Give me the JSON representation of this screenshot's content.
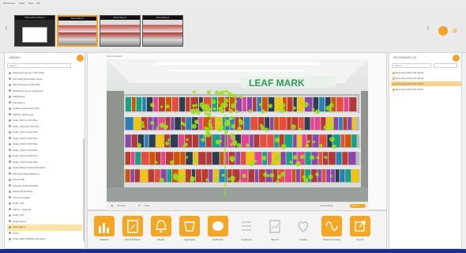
{
  "menubar": {
    "items": [
      "Workspace",
      "Study",
      "Help",
      "Info"
    ]
  },
  "filmstrip": {
    "thumbnails": [
      {
        "caption": "Scene/Recording 1",
        "label": "Scene/Recording",
        "selected": false
      },
      {
        "caption": "Recording 2",
        "selected": true
      },
      {
        "caption": "Recording 3",
        "selected": false
      },
      {
        "caption": "Recording 4",
        "selected": false
      }
    ]
  },
  "library": {
    "title": "LIBRARY",
    "search_placeholder": "Search",
    "items": [
      "Participant Group 1 (F01-F09)",
      "F01 Shelf View Study Group",
      "F02 Participant (F05-F08)",
      "Participant Group (Aug/Sept)",
      "Participants",
      "F03 Gaze 1",
      "Healthy Foods (F01-F09)",
      "F04/F5 - Shelf Light",
      "Study_F01 for F01 Plan",
      "Study_F01-F02 F01 Plan",
      "Study_F02 for F01 Plan",
      "Study_F02 for F02 Plan",
      "Study_F03 for F03 Plan",
      "Study_F03 for F04 Plan",
      "Study_F04 for F05 Plan",
      "Study_F04 for F06 Plan",
      "Study Markers (F01-F09) 2019",
      "F05 Final Shelf Markers F",
      "Variant A/B",
      "Selection (F01-F09 A/B)",
      "Variant Recordings",
      "Video Annotated",
      "Study_F09",
      "F06 10 - Shelf 04",
      "Study_F07",
      "Study Export",
      "Shelf aisle 3",
      "F0 F1",
      "Study Data F08/F09 (old study)"
    ],
    "selected_index": 26
  },
  "viewer": {
    "header": "Scene Camera",
    "store_sign": "LEAF MARK",
    "controls": {
      "speed": "Normal",
      "mode": "Gaze",
      "status": "● Recording",
      "action": "Export"
    }
  },
  "recordings": {
    "title": "RECORDINGS (3)",
    "search_placeholder": "Search",
    "items": [
      "Recording (F01 F01 Shelf)",
      "Recording (F02 F01 Shelf)",
      "Recording (F03 F01 Shelf)",
      "Recording (F04 F01 Shelf)"
    ],
    "selected_index": 2
  },
  "toolbar": {
    "tools": [
      {
        "label": "Statistics",
        "icon": "bar-chart-icon",
        "active": true
      },
      {
        "label": "AOI & Markers",
        "icon": "document-icon",
        "active": true
      },
      {
        "label": "Replay",
        "icon": "bell-icon",
        "active": true
      },
      {
        "label": "Aggregate",
        "icon": "cup-icon",
        "active": true
      },
      {
        "label": "Heatmaps",
        "icon": "blob-icon",
        "active": true
      },
      {
        "label": "Sequence",
        "icon": "list-icon",
        "active": false
      },
      {
        "label": "Metrics",
        "icon": "doc-chart-icon",
        "active": false
      },
      {
        "label": "Coding",
        "icon": "heart-icon",
        "active": false
      },
      {
        "label": "Data Processing",
        "icon": "wave-icon",
        "active": true
      },
      {
        "label": "Export",
        "icon": "export-icon",
        "active": true
      }
    ]
  },
  "colors": {
    "accent": "#f5a623",
    "gaze": "#9be21a",
    "taskbar": "#1d2b8c"
  }
}
